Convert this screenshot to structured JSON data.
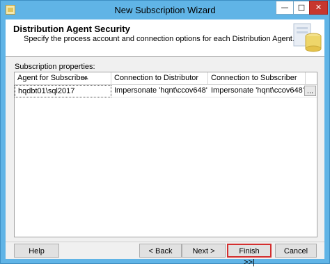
{
  "window": {
    "title": "New Subscription Wizard",
    "minimize_glyph": "—",
    "maximize_glyph": "□",
    "close_glyph": "✕"
  },
  "header": {
    "title": "Distribution Agent Security",
    "subtitle": "Specify the process account and connection options for each Distribution Agent."
  },
  "subscription_properties": {
    "label": "Subscription properties:",
    "columns": [
      "Agent for Subscriber",
      "Connection to Distributor",
      "Connection to Subscriber"
    ],
    "sort_column": "Agent for Subscriber",
    "sort_direction": "ascending",
    "rows": [
      {
        "agent": "hqdbt01\\sql2017",
        "distributor": "Impersonate 'hqnt\\ccov648'",
        "subscriber": "Impersonate 'hqnt\\ccov648'",
        "button": "..."
      }
    ]
  },
  "buttons": {
    "help": "Help",
    "back": "< Back",
    "next": "Next >",
    "finish": "Finish >>|",
    "cancel": "Cancel"
  },
  "colors": {
    "title_bar": "#60b4e6",
    "close_button": "#c7372f",
    "finish_highlight": "#d32f2f"
  },
  "icons": {
    "app": "wizard-app-icon",
    "header": "database-server-icon",
    "sort": "sort-ascending-icon"
  }
}
